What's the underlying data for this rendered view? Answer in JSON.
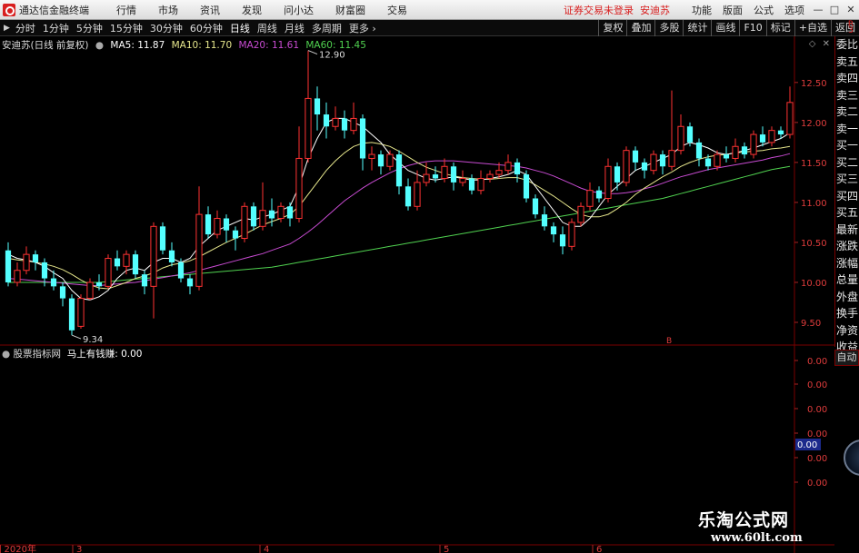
{
  "app": {
    "name": "通达信金融终端",
    "warning": "证券交易未登录",
    "stock_name": "安迪苏"
  },
  "menu": [
    "行情",
    "市场",
    "资讯",
    "发现",
    "问小达",
    "财富圈",
    "交易"
  ],
  "right_menu": [
    "功能",
    "版面",
    "公式",
    "选项"
  ],
  "window_buttons": [
    "—",
    "□",
    "✕"
  ],
  "period_tabs": [
    "分时",
    "1分钟",
    "5分钟",
    "15分钟",
    "30分钟",
    "60分钟",
    "日线",
    "周线",
    "月线",
    "多周期",
    "更多"
  ],
  "active_tab": "日线",
  "tool_tabs": [
    "复权",
    "叠加",
    "多股",
    "统计",
    "画线",
    "F10",
    "标记",
    "+自选",
    "返回"
  ],
  "info": {
    "title": "安迪苏(日线 前复权)",
    "ma5": "MA5: 11.87",
    "ma10": "MA10: 11.70",
    "ma20": "MA20: 11.61",
    "ma60": "MA60: 11.45"
  },
  "sub": {
    "title": "股票指标网",
    "indicator": "马上有钱赚: 0.00"
  },
  "chart_ctrl": "◇ ✕",
  "right_panel": [
    "委比",
    "卖五",
    "卖四",
    "卖三",
    "卖二",
    "卖一",
    "买一",
    "买二",
    "买三",
    "买四",
    "买五",
    "最新",
    "涨跌",
    "涨幅",
    "总量",
    "外盘",
    "换手",
    "净资",
    "收益"
  ],
  "auto_button": "自动",
  "right_dot": "R\n3",
  "watermark": {
    "title": "乐淘公式网",
    "url": "www.60lt.com"
  },
  "colors": {
    "up": "#ff3232",
    "down": "#54ffff",
    "ma5": "#ffffff",
    "ma10": "#e6e68c",
    "ma20": "#c84bd2",
    "ma60": "#50d250"
  },
  "chart_data": {
    "type": "candlestick",
    "ylim": [
      9.25,
      12.85
    ],
    "price_ticks": [
      "12.50",
      "12.00",
      "11.50",
      "11.00",
      "10.50",
      "10.00",
      "9.50"
    ],
    "sub_ticks": [
      "0.00",
      "0.00",
      "0.00",
      "0.00",
      "0.00",
      "0.00"
    ],
    "sub_current": "0.00",
    "date_labels": [
      "2020年",
      "3",
      "4",
      "5",
      "6"
    ],
    "high_label": "12.90",
    "low_label": "9.34",
    "marker": "B",
    "candles": [
      [
        10.4,
        10.0,
        10.5,
        9.95
      ],
      [
        10.0,
        10.15,
        10.25,
        9.95
      ],
      [
        10.15,
        10.35,
        10.45,
        10.1
      ],
      [
        10.35,
        10.25,
        10.4,
        10.15
      ],
      [
        10.25,
        10.05,
        10.3,
        9.95
      ],
      [
        10.05,
        9.95,
        10.15,
        9.9
      ],
      [
        9.95,
        9.8,
        10.0,
        9.7
      ],
      [
        9.8,
        9.4,
        9.85,
        9.34
      ],
      [
        9.45,
        9.8,
        9.85,
        9.42
      ],
      [
        9.8,
        10.0,
        10.05,
        9.78
      ],
      [
        10.0,
        9.95,
        10.1,
        9.9
      ],
      [
        9.95,
        10.3,
        10.35,
        9.92
      ],
      [
        10.3,
        10.2,
        10.4,
        10.15
      ],
      [
        10.2,
        10.35,
        10.4,
        10.1
      ],
      [
        10.35,
        10.1,
        10.4,
        10.05
      ],
      [
        10.1,
        9.95,
        10.15,
        9.85
      ],
      [
        9.95,
        10.7,
        10.75,
        9.55
      ],
      [
        10.7,
        10.4,
        10.75,
        10.35
      ],
      [
        10.4,
        10.25,
        10.5,
        10.2
      ],
      [
        10.25,
        10.05,
        10.3,
        10.0
      ],
      [
        10.05,
        9.95,
        10.1,
        9.85
      ],
      [
        9.95,
        10.85,
        11.2,
        9.9
      ],
      [
        10.85,
        10.6,
        10.95,
        10.55
      ],
      [
        10.6,
        10.8,
        10.9,
        10.55
      ],
      [
        10.8,
        10.65,
        10.85,
        10.5
      ],
      [
        10.65,
        10.55,
        10.7,
        10.4
      ],
      [
        10.55,
        10.95,
        11.0,
        10.5
      ],
      [
        10.95,
        10.7,
        11.0,
        10.65
      ],
      [
        10.7,
        10.9,
        11.25,
        10.65
      ],
      [
        10.9,
        10.8,
        11.05,
        10.7
      ],
      [
        10.8,
        10.95,
        11.0,
        10.75
      ],
      [
        10.95,
        10.8,
        11.0,
        10.7
      ],
      [
        10.8,
        11.55,
        11.95,
        10.75
      ],
      [
        11.55,
        12.3,
        12.9,
        11.5
      ],
      [
        12.3,
        12.1,
        12.45,
        11.9
      ],
      [
        12.1,
        11.95,
        12.25,
        11.8
      ],
      [
        11.95,
        12.05,
        12.2,
        11.9
      ],
      [
        12.05,
        11.9,
        12.15,
        11.8
      ],
      [
        11.9,
        12.05,
        12.25,
        11.85
      ],
      [
        12.05,
        11.55,
        12.1,
        11.4
      ],
      [
        11.55,
        11.6,
        11.7,
        11.4
      ],
      [
        11.6,
        11.45,
        11.65,
        11.35
      ],
      [
        11.45,
        11.6,
        11.65,
        11.4
      ],
      [
        11.6,
        11.2,
        11.65,
        11.1
      ],
      [
        11.2,
        10.95,
        11.3,
        10.9
      ],
      [
        10.95,
        11.25,
        11.4,
        10.9
      ],
      [
        11.25,
        11.35,
        11.5,
        11.2
      ],
      [
        11.35,
        11.3,
        11.45,
        11.25
      ],
      [
        11.3,
        11.45,
        11.55,
        11.25
      ],
      [
        11.45,
        11.25,
        11.5,
        11.15
      ],
      [
        11.25,
        11.3,
        11.4,
        11.2
      ],
      [
        11.3,
        11.15,
        11.35,
        11.1
      ],
      [
        11.15,
        11.3,
        11.4,
        11.1
      ],
      [
        11.3,
        11.35,
        11.4,
        11.25
      ],
      [
        11.35,
        11.4,
        11.5,
        11.3
      ],
      [
        11.4,
        11.5,
        11.6,
        11.35
      ],
      [
        11.5,
        11.35,
        11.55,
        11.25
      ],
      [
        11.35,
        11.05,
        11.4,
        11.0
      ],
      [
        11.05,
        10.85,
        11.1,
        10.8
      ],
      [
        10.85,
        10.7,
        10.95,
        10.65
      ],
      [
        10.7,
        10.6,
        10.75,
        10.5
      ],
      [
        10.6,
        10.45,
        10.7,
        10.35
      ],
      [
        10.45,
        10.75,
        10.8,
        10.4
      ],
      [
        10.75,
        10.95,
        11.0,
        10.7
      ],
      [
        10.95,
        11.15,
        11.25,
        10.9
      ],
      [
        11.15,
        11.05,
        11.2,
        11.0
      ],
      [
        11.05,
        11.45,
        11.55,
        11.0
      ],
      [
        11.45,
        11.25,
        11.5,
        11.15
      ],
      [
        11.25,
        11.65,
        11.7,
        11.2
      ],
      [
        11.65,
        11.5,
        11.7,
        11.4
      ],
      [
        11.5,
        11.4,
        11.55,
        11.3
      ],
      [
        11.4,
        11.6,
        11.65,
        11.35
      ],
      [
        11.6,
        11.45,
        11.65,
        11.35
      ],
      [
        11.45,
        11.65,
        12.4,
        11.4
      ],
      [
        11.65,
        11.95,
        12.1,
        11.6
      ],
      [
        11.95,
        11.75,
        12.0,
        11.7
      ],
      [
        11.75,
        11.55,
        11.8,
        11.45
      ],
      [
        11.55,
        11.45,
        11.6,
        11.4
      ],
      [
        11.45,
        11.6,
        11.65,
        11.4
      ],
      [
        11.6,
        11.55,
        11.7,
        11.5
      ],
      [
        11.55,
        11.7,
        11.8,
        11.5
      ],
      [
        11.7,
        11.6,
        11.75,
        11.55
      ],
      [
        11.6,
        11.85,
        11.9,
        11.55
      ],
      [
        11.85,
        11.75,
        11.95,
        11.7
      ],
      [
        11.75,
        11.9,
        11.95,
        11.7
      ],
      [
        11.9,
        11.85,
        11.95,
        11.8
      ],
      [
        11.85,
        12.25,
        12.45,
        11.8
      ]
    ],
    "ma5": [
      10.35,
      10.3,
      10.28,
      10.25,
      10.2,
      10.12,
      10.05,
      9.9,
      9.8,
      9.78,
      9.82,
      9.9,
      10.05,
      10.15,
      10.18,
      10.15,
      10.25,
      10.3,
      10.3,
      10.25,
      10.3,
      10.45,
      10.55,
      10.65,
      10.7,
      10.75,
      10.8,
      10.78,
      10.82,
      10.85,
      10.9,
      10.95,
      11.2,
      11.55,
      11.8,
      12.0,
      12.05,
      12.05,
      12.0,
      11.95,
      11.85,
      11.75,
      11.6,
      11.5,
      11.4,
      11.35,
      11.3,
      11.28,
      11.3,
      11.32,
      11.3,
      11.28,
      11.28,
      11.3,
      11.32,
      11.35,
      11.4,
      11.35,
      11.2,
      11.05,
      10.9,
      10.75,
      10.7,
      10.7,
      10.8,
      10.95,
      11.1,
      11.2,
      11.3,
      11.4,
      11.45,
      11.5,
      11.55,
      11.6,
      11.7,
      11.75,
      11.72,
      11.68,
      11.62,
      11.6,
      11.62,
      11.65,
      11.68,
      11.72,
      11.76,
      11.8,
      11.87
    ],
    "ma10": [
      10.3,
      10.28,
      10.27,
      10.25,
      10.23,
      10.2,
      10.16,
      10.1,
      10.03,
      9.97,
      9.93,
      9.92,
      9.96,
      10.0,
      10.05,
      10.08,
      10.12,
      10.18,
      10.22,
      10.24,
      10.27,
      10.32,
      10.38,
      10.44,
      10.5,
      10.55,
      10.6,
      10.66,
      10.72,
      10.76,
      10.8,
      10.85,
      10.95,
      11.1,
      11.25,
      11.4,
      11.52,
      11.62,
      11.7,
      11.74,
      11.75,
      11.73,
      11.7,
      11.64,
      11.57,
      11.5,
      11.44,
      11.4,
      11.36,
      11.33,
      11.31,
      11.3,
      11.29,
      11.29,
      11.3,
      11.31,
      11.31,
      11.28,
      11.22,
      11.15,
      11.08,
      11.0,
      10.92,
      10.85,
      10.82,
      10.82,
      10.85,
      10.92,
      11.0,
      11.1,
      11.18,
      11.25,
      11.32,
      11.38,
      11.45,
      11.5,
      11.54,
      11.57,
      11.59,
      11.6,
      11.62,
      11.63,
      11.64,
      11.65,
      11.67,
      11.68,
      11.7
    ],
    "ma20": [
      10.05,
      10.04,
      10.03,
      10.02,
      10.01,
      10.0,
      9.99,
      9.98,
      9.97,
      9.96,
      9.96,
      9.97,
      9.98,
      9.99,
      10.0,
      10.02,
      10.04,
      10.06,
      10.08,
      10.1,
      10.12,
      10.15,
      10.18,
      10.21,
      10.24,
      10.27,
      10.3,
      10.33,
      10.36,
      10.4,
      10.44,
      10.48,
      10.55,
      10.63,
      10.72,
      10.82,
      10.92,
      11.02,
      11.1,
      11.18,
      11.25,
      11.31,
      11.37,
      11.42,
      11.46,
      11.49,
      11.51,
      11.52,
      11.52,
      11.52,
      11.51,
      11.5,
      11.49,
      11.48,
      11.47,
      11.46,
      11.45,
      11.43,
      11.4,
      11.37,
      11.33,
      11.28,
      11.23,
      11.18,
      11.14,
      11.12,
      11.11,
      11.11,
      11.12,
      11.14,
      11.17,
      11.2,
      11.24,
      11.28,
      11.32,
      11.35,
      11.38,
      11.41,
      11.43,
      11.45,
      11.47,
      11.49,
      11.51,
      11.53,
      11.56,
      11.58,
      11.61
    ],
    "ma60": [
      10.0,
      10.0,
      10.0,
      10.0,
      10.0,
      10.0,
      10.0,
      10.0,
      10.0,
      10.0,
      10.0,
      10.01,
      10.02,
      10.03,
      10.04,
      10.05,
      10.06,
      10.07,
      10.08,
      10.09,
      10.1,
      10.11,
      10.12,
      10.13,
      10.14,
      10.15,
      10.16,
      10.17,
      10.18,
      10.19,
      10.21,
      10.23,
      10.25,
      10.27,
      10.29,
      10.31,
      10.33,
      10.35,
      10.37,
      10.39,
      10.41,
      10.43,
      10.45,
      10.47,
      10.49,
      10.51,
      10.53,
      10.55,
      10.57,
      10.59,
      10.61,
      10.63,
      10.65,
      10.67,
      10.69,
      10.71,
      10.73,
      10.75,
      10.77,
      10.79,
      10.81,
      10.83,
      10.85,
      10.87,
      10.89,
      10.91,
      10.93,
      10.95,
      10.97,
      10.99,
      11.01,
      11.03,
      11.05,
      11.08,
      11.11,
      11.14,
      11.17,
      11.2,
      11.23,
      11.26,
      11.29,
      11.32,
      11.35,
      11.38,
      11.41,
      11.43,
      11.45
    ]
  }
}
